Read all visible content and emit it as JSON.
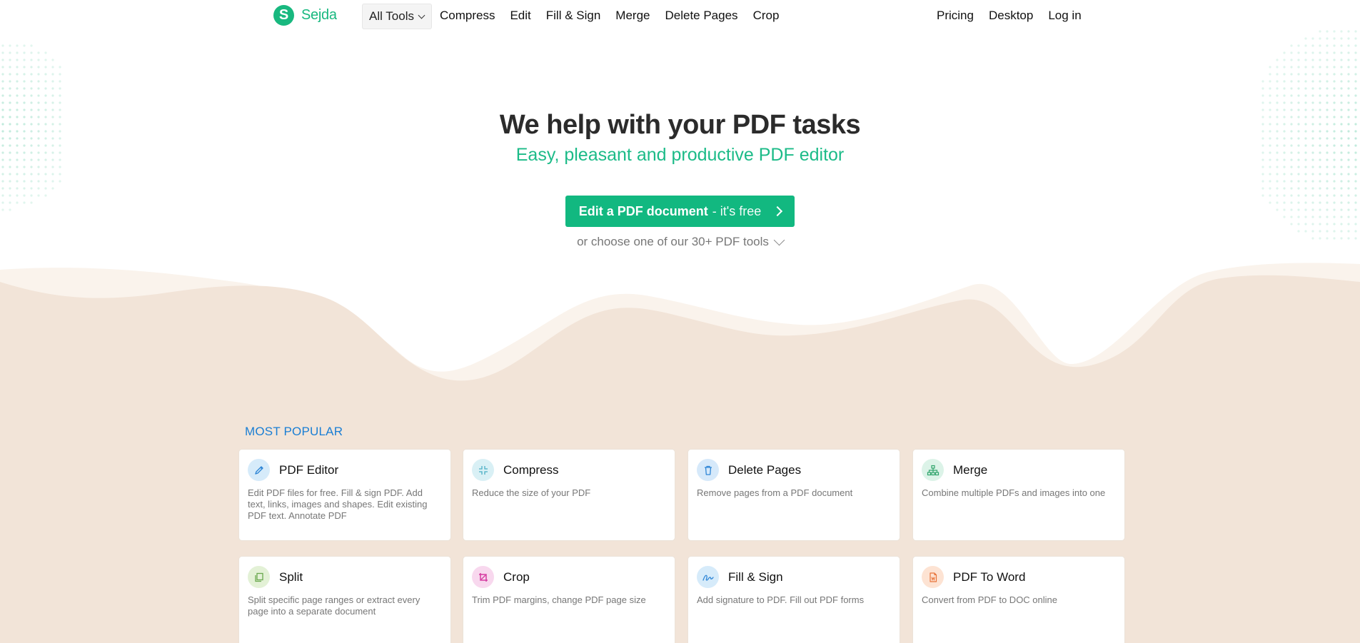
{
  "header": {
    "logo_mark": "S",
    "logo_text": "Sejda",
    "all_tools_label": "All Tools",
    "nav_links": [
      "Compress",
      "Edit",
      "Fill & Sign",
      "Merge",
      "Delete Pages",
      "Crop"
    ],
    "right_links": [
      "Pricing",
      "Desktop",
      "Log in"
    ]
  },
  "hero": {
    "title": "We help with your PDF tasks",
    "subtitle": "Easy, pleasant and productive PDF editor",
    "cta_bold": "Edit a PDF document",
    "cta_light": "- it's free",
    "choose_text": "or choose one of our 30+ PDF tools"
  },
  "popular": {
    "label": "MOST POPULAR",
    "cards": [
      {
        "title": "PDF Editor",
        "desc": "Edit PDF files for free. Fill & sign PDF. Add text, links, images and shapes. Edit existing PDF text. Annotate PDF",
        "icon": "pencil-icon",
        "icon_bg": "#d6ebfa",
        "icon_color": "#2f86d6"
      },
      {
        "title": "Compress",
        "desc": "Reduce the size of your PDF",
        "icon": "compress-icon",
        "icon_bg": "#d9f0f5",
        "icon_color": "#4aaec4"
      },
      {
        "title": "Delete Pages",
        "desc": "Remove pages from a PDF document",
        "icon": "trash-icon",
        "icon_bg": "#d6e9fa",
        "icon_color": "#2f86d6"
      },
      {
        "title": "Merge",
        "desc": "Combine multiple PDFs and images into one",
        "icon": "merge-icon",
        "icon_bg": "#dcf3e8",
        "icon_color": "#30a46c"
      },
      {
        "title": "Split",
        "desc": "Split specific page ranges or extract every page into a separate document",
        "icon": "split-icon",
        "icon_bg": "#e3f1d6",
        "icon_color": "#6aa84f"
      },
      {
        "title": "Crop",
        "desc": "Trim PDF margins, change PDF page size",
        "icon": "crop-icon",
        "icon_bg": "#f8d8ee",
        "icon_color": "#d63aa0"
      },
      {
        "title": "Fill & Sign",
        "desc": "Add signature to PDF. Fill out PDF forms",
        "icon": "signature-icon",
        "icon_bg": "#d6ebfa",
        "icon_color": "#2f86d6"
      },
      {
        "title": "PDF To Word",
        "desc": "Convert from PDF to DOC online",
        "icon": "word-doc-icon",
        "icon_bg": "#fde3d3",
        "icon_color": "#e8743b"
      }
    ]
  },
  "colors": {
    "brand": "#18b87f",
    "cta": "#12b880",
    "beige": "#f2e4d8",
    "beige_light": "#faf3ec",
    "section_label": "#1a7ed4"
  }
}
